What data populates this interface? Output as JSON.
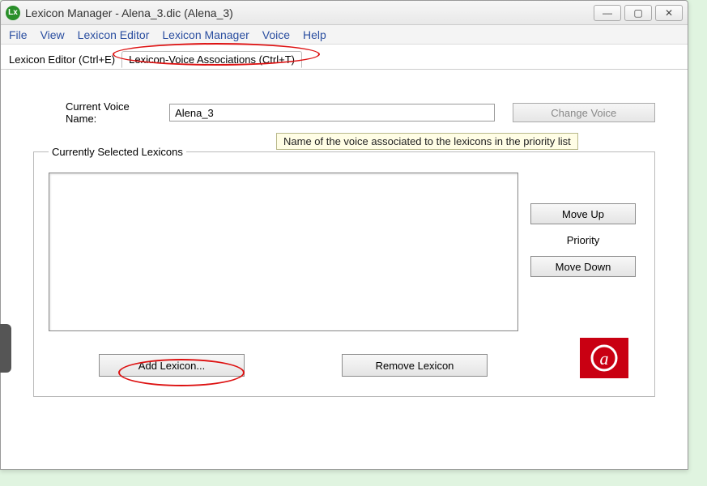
{
  "titlebar": {
    "title": "Lexicon Manager - Alena_3.dic (Alena_3)"
  },
  "menubar": {
    "items": [
      "File",
      "View",
      "Lexicon Editor",
      "Lexicon Manager",
      "Voice",
      "Help"
    ]
  },
  "tabs": {
    "editor_label": "Lexicon Editor (Ctrl+E)",
    "assoc_label": "Lexicon-Voice Associations (Ctrl+T)"
  },
  "form": {
    "voice_name_label": "Current Voice Name:",
    "voice_name_value": "Alena_3",
    "change_voice_label": "Change Voice",
    "tooltip": "Name of the voice associated to the lexicons in the priority list"
  },
  "groupbox": {
    "legend": "Currently Selected Lexicons",
    "move_up": "Move Up",
    "priority_label": "Priority",
    "move_down": "Move Down",
    "add_lexicon": "Add Lexicon...",
    "remove_lexicon": "Remove Lexicon"
  }
}
